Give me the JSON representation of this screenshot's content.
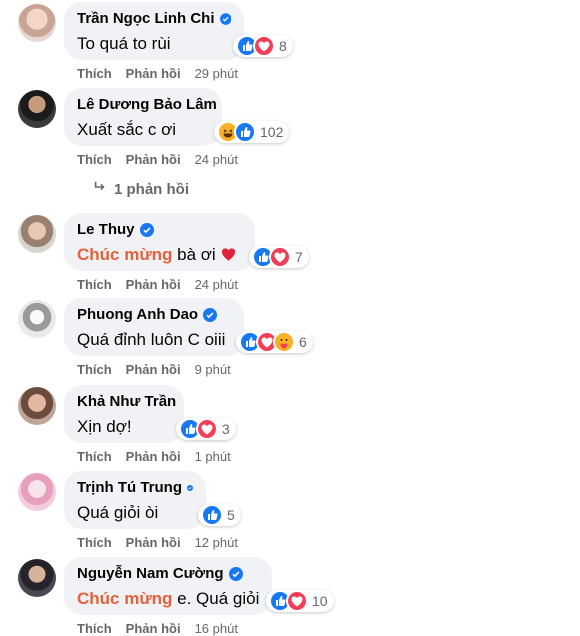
{
  "comments": [
    {
      "author": "Trần Ngọc Linh Chi",
      "verified": true,
      "text": "To quá to rùi",
      "highlight": "",
      "reactions": [
        "like",
        "love"
      ],
      "count": "8",
      "like": "Thích",
      "reply": "Phản hồi",
      "time": "29 phút"
    },
    {
      "author": "Lê Dương Bảo Lâm",
      "verified": false,
      "text": "Xuất sắc c ơi",
      "highlight": "",
      "reactions": [
        "haha",
        "like"
      ],
      "count": "102",
      "like": "Thích",
      "reply": "Phản hồi",
      "time": "24 phút"
    },
    {
      "author": "Le Thuy",
      "verified": true,
      "text": " bà ơi",
      "highlight": "Chúc mừng",
      "emoji": "heart",
      "reactions": [
        "like",
        "love"
      ],
      "count": "7",
      "like": "Thích",
      "reply": "Phản hồi",
      "time": "24 phút"
    },
    {
      "author": "Phuong Anh Dao",
      "verified": true,
      "text": "Quá đỉnh luôn C oiii",
      "highlight": "",
      "reactions": [
        "like",
        "love",
        "care"
      ],
      "count": "6",
      "like": "Thích",
      "reply": "Phản hồi",
      "time": "9 phút"
    },
    {
      "author": "Khả Như Trần",
      "verified": false,
      "text": "Xịn dợ!",
      "highlight": "",
      "reactions": [
        "like",
        "love"
      ],
      "count": "3",
      "like": "Thích",
      "reply": "Phản hồi",
      "time": "1 phút"
    },
    {
      "author": "Trịnh Tú Trung",
      "verified": true,
      "text": "Quá giỏi òi",
      "highlight": "",
      "reactions": [
        "like"
      ],
      "count": "5",
      "like": "Thích",
      "reply": "Phản hồi",
      "time": "12 phút"
    },
    {
      "author": "Nguyễn Nam Cường",
      "verified": true,
      "text": " e. Quá giỏi",
      "highlight": "Chúc mừng",
      "reactions": [
        "like",
        "love"
      ],
      "count": "10",
      "like": "Thích",
      "reply": "Phản hồi",
      "time": "16 phút"
    }
  ],
  "replies_link": "1 phản hồi",
  "colors": {
    "like": "#1877f2",
    "love": "#f33e58",
    "haha": "#f7b125",
    "verified": "#1877f2",
    "highlight": "#e4613c",
    "bubble": "#f0f2f5",
    "meta": "#65676b"
  }
}
